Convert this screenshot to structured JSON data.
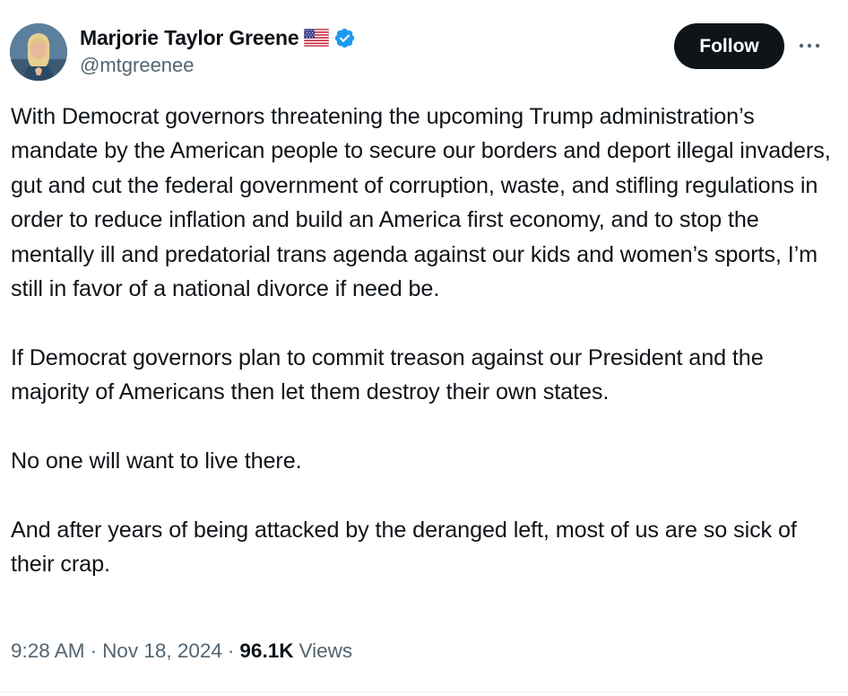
{
  "author": {
    "display_name": "Marjorie Taylor Greene",
    "handle": "@mtgreenee",
    "flag_icon": "us-flag-icon",
    "verified_icon": "verified-badge-icon",
    "verified_color": "#1d9bf0"
  },
  "actions": {
    "follow_label": "Follow",
    "more_icon": "more-horizontal-icon"
  },
  "tweet": {
    "paragraphs": [
      "With Democrat governors threatening the upcoming Trump administration’s mandate by the American people to secure our borders and deport illegal invaders, gut and cut the federal government of corruption, waste, and stifling regulations in order to reduce inflation and build an America first economy, and to stop the mentally ill and predatorial trans agenda against our kids and women’s sports, I’m still in favor of a national divorce if need be.",
      "If Democrat governors plan to commit treason against our President and the majority of Americans then let them destroy their own states.",
      "No one will want to live there.",
      "And after years of being attacked by the deranged left, most of us are so sick of their crap."
    ]
  },
  "meta": {
    "time": "9:28 AM",
    "date": "Nov 18, 2024",
    "separator": "·",
    "views_count": "96.1K",
    "views_label": "Views"
  },
  "colors": {
    "text_primary": "#0f1419",
    "text_secondary": "#536471",
    "button_bg": "#0f1419"
  }
}
